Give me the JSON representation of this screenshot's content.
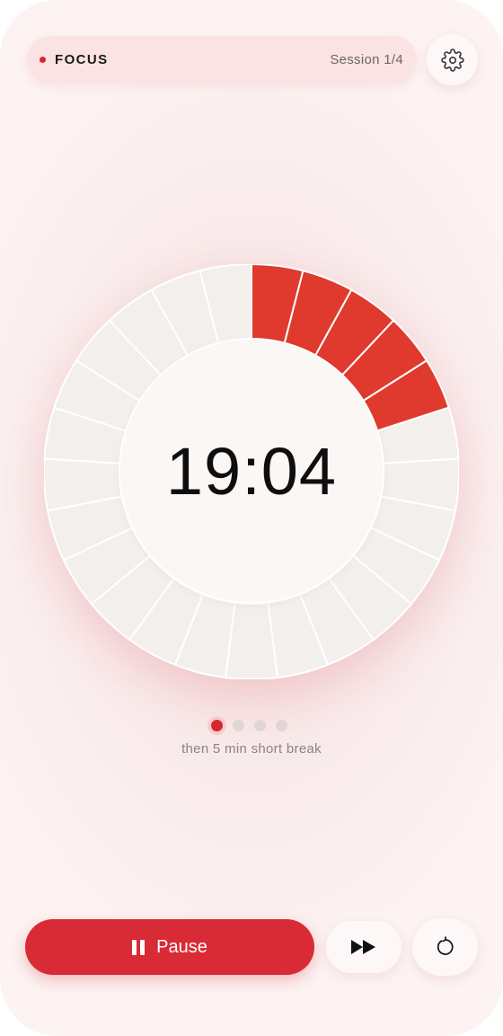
{
  "header": {
    "mode": "FOCUS",
    "session": "Session 1/4",
    "settings_icon": "gear-icon"
  },
  "timer": {
    "time": "19:04",
    "total_segments": 25,
    "filled_segments": 5,
    "fill_color": "#e03a2e",
    "empty_color": "#f3efed"
  },
  "sessions": {
    "count": 4,
    "current": 1,
    "next_label": "then 5 min short break"
  },
  "controls": {
    "pause_label": "Pause",
    "pause_icon": "pause-icon",
    "skip_icon": "fast-forward-icon",
    "reset_icon": "restart-icon"
  },
  "colors": {
    "accent": "#d92b36",
    "background": "#f9eaea"
  }
}
